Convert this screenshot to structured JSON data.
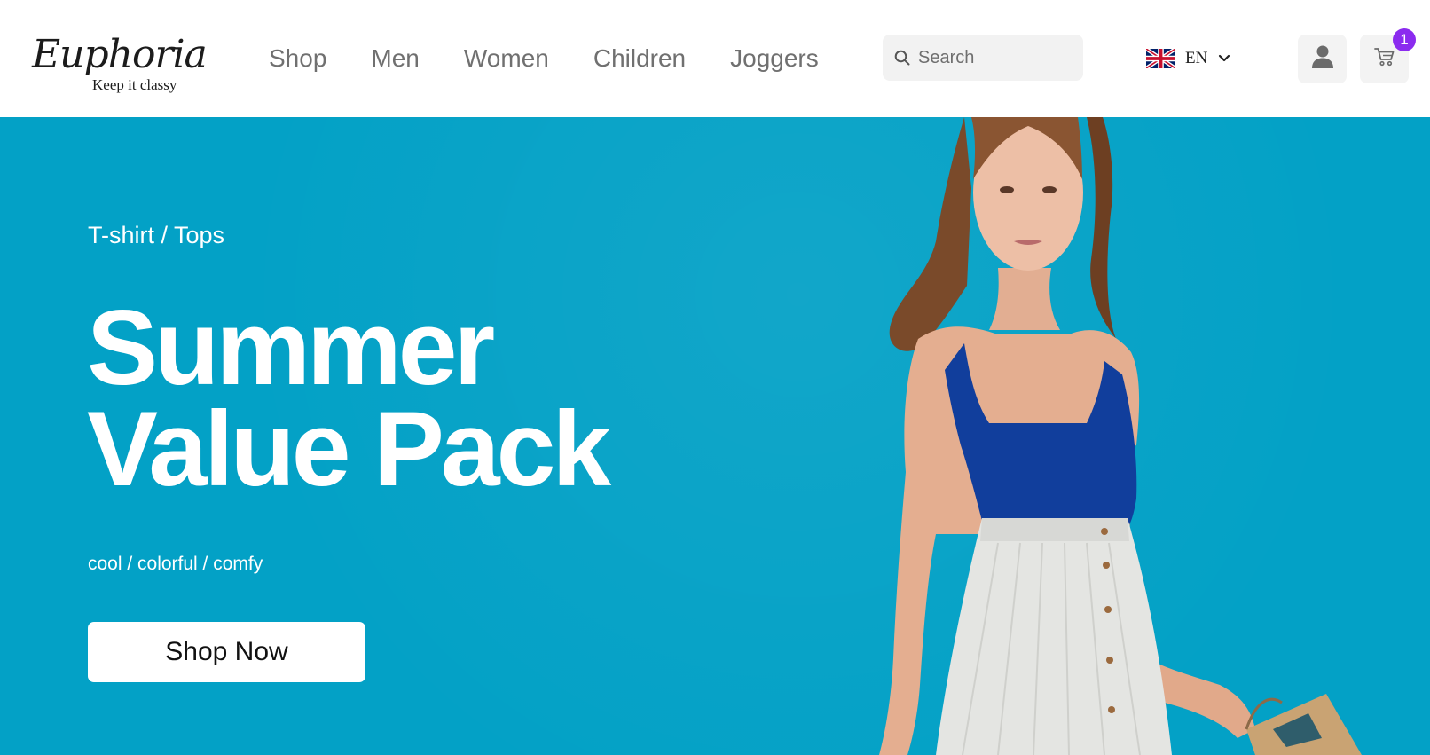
{
  "brand": {
    "name": "Euphoria",
    "tagline": "Keep it classy"
  },
  "nav": {
    "items": [
      {
        "label": "Shop"
      },
      {
        "label": "Men"
      },
      {
        "label": "Women"
      },
      {
        "label": "Children"
      },
      {
        "label": "Joggers"
      }
    ]
  },
  "search": {
    "placeholder": "Search",
    "icon": "search-icon"
  },
  "language": {
    "label": "EN",
    "flag": "uk-flag-icon",
    "icon": "chevron-down-icon"
  },
  "account": {
    "icon": "user-icon"
  },
  "cart": {
    "icon": "cart-icon",
    "count": "1"
  },
  "hero": {
    "subtitle": "T-shirt / Tops",
    "headline_line1": "Summer",
    "headline_line2": "Value Pack",
    "tagline": "cool / colorful / comfy",
    "cta_label": "Shop Now"
  },
  "colors": {
    "hero_bg": "#03a1c6",
    "badge": "#8b2bef",
    "nav_text": "#707070",
    "top": "#113e9c",
    "skirt": "#e4e5e2"
  }
}
